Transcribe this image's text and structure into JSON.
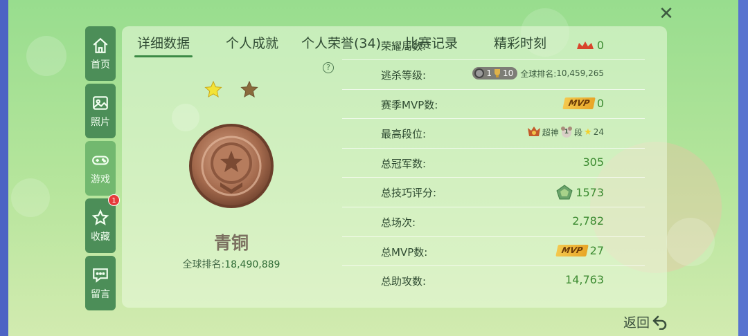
{
  "nav": {
    "items": [
      {
        "label": "首页",
        "icon": "home-icon"
      },
      {
        "label": "照片",
        "icon": "photo-icon"
      },
      {
        "label": "游戏",
        "icon": "gamepad-icon"
      },
      {
        "label": "收藏",
        "icon": "favorite-icon",
        "badge": "1"
      },
      {
        "label": "留言",
        "icon": "message-icon"
      }
    ]
  },
  "tabs": [
    "详细数据",
    "个人成就",
    "个人荣誉(34)",
    "比赛记录",
    "精彩时刻"
  ],
  "rank": {
    "title": "青铜",
    "global_label": "全球排名:",
    "global_value": "18,490,889",
    "stars_filled": 1,
    "stars_total": 2
  },
  "stats": {
    "honor_label": "荣耀局数:",
    "honor_value": "0",
    "escape_label": "逃杀等级:",
    "escape_level_badge": "1",
    "escape_level": "10",
    "escape_rank_label": "全球排名:",
    "escape_rank_value": "10,459,265",
    "season_mvp_label": "赛季MVP数:",
    "season_mvp_tag": "MVP",
    "season_mvp_value": "0",
    "highest_label": "最高段位:",
    "highest_tier1": "超神",
    "highest_tier2_num": "1",
    "highest_tier2": "段",
    "highest_stars": "24",
    "champion_label": "总冠军数:",
    "champion_value": "305",
    "skill_label": "总技巧评分:",
    "skill_value": "1573",
    "matches_label": "总场次:",
    "matches_value": "2,782",
    "total_mvp_label": "总MVP数:",
    "total_mvp_tag": "MVP",
    "total_mvp_value": "27",
    "assists_label": "总助攻数:",
    "assists_value": "14,763"
  },
  "back_label": "返回",
  "colors": {
    "accent": "#3b8a30",
    "nav": "#4c8e58",
    "nav_active": "#72b86f",
    "badge": "#e63a3a"
  }
}
